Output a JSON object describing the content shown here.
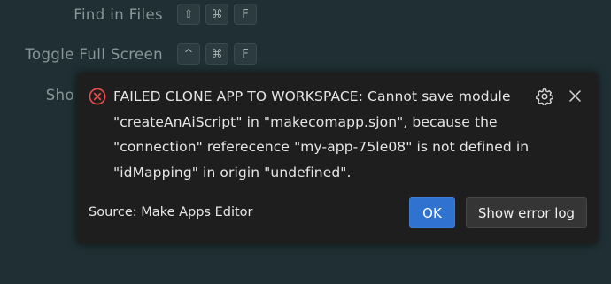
{
  "shortcuts": [
    {
      "label": "Find in Files",
      "keys": [
        "⇧",
        "⌘",
        "F"
      ]
    },
    {
      "label": "Toggle Full Screen",
      "keys": [
        "^",
        "⌘",
        "F"
      ]
    },
    {
      "label": "Sho"
    }
  ],
  "notification": {
    "message": "FAILED CLONE APP TO WORKSPACE: Cannot save module \"createAnAiScript\" in \"makecomapp.sjon\", because the \"connection\" referecence \"my-app-75le08\" is not defined in \"idMapping\" in origin \"undefined\".",
    "source": "Source: Make Apps Editor",
    "ok_label": "OK",
    "show_log_label": "Show error log",
    "error_color": "#f14c4c",
    "primary_color": "#2f72cf"
  }
}
